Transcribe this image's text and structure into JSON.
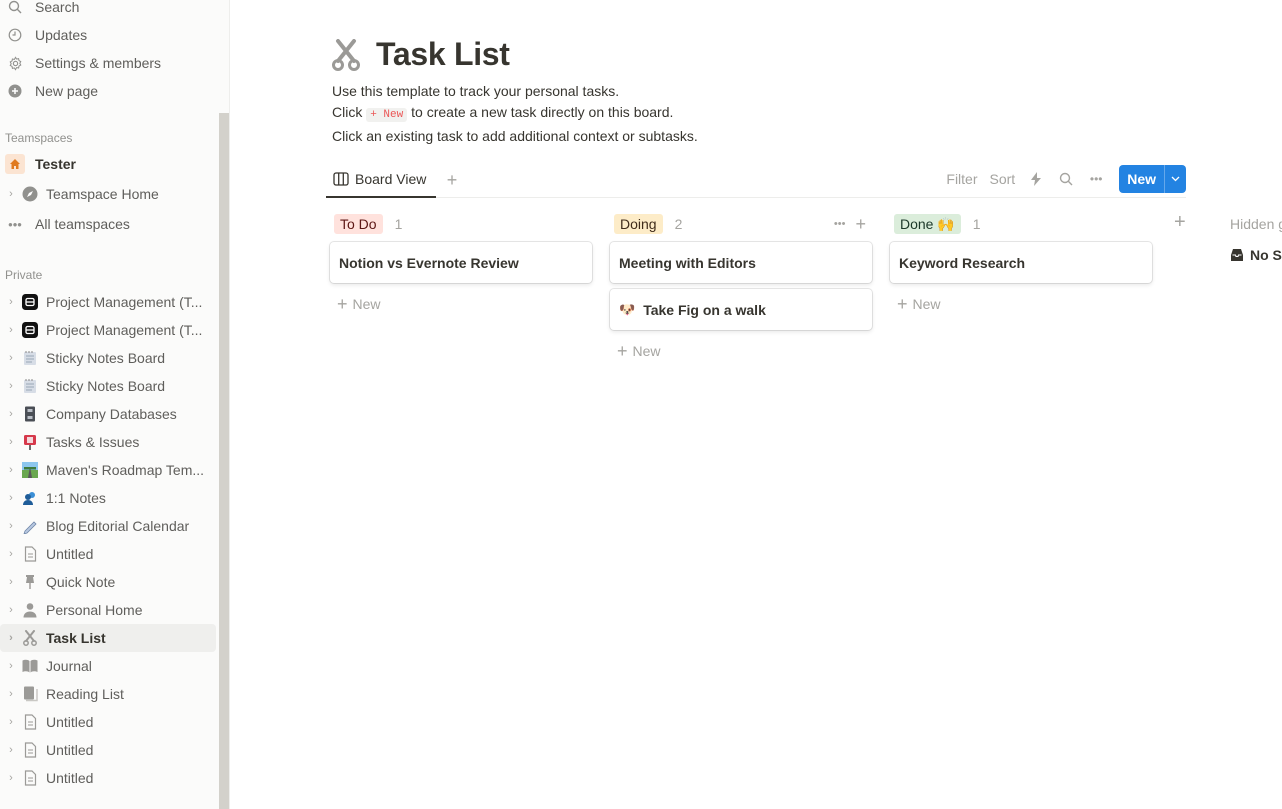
{
  "sidebar": {
    "top_items": [
      {
        "label": "Search",
        "icon": "search-icon"
      },
      {
        "label": "Updates",
        "icon": "clock-icon"
      },
      {
        "label": "Settings & members",
        "icon": "gear-icon"
      },
      {
        "label": "New page",
        "icon": "plus-circle-icon"
      }
    ],
    "teamspaces_header": "Teamspaces",
    "teamspaces": [
      {
        "label": "Tester",
        "icon": "home-icon"
      },
      {
        "label": "Teamspace Home",
        "icon": "compass-icon"
      },
      {
        "label": "All teamspaces",
        "icon": "more-icon"
      }
    ],
    "private_header": "Private",
    "private": [
      {
        "label": "Project Management (T...",
        "icon": "notion-app-icon"
      },
      {
        "label": "Project Management (T...",
        "icon": "notion-app-icon"
      },
      {
        "label": "Sticky Notes Board",
        "icon": "notepad-icon"
      },
      {
        "label": "Sticky Notes Board",
        "icon": "notepad-icon"
      },
      {
        "label": "Company Databases",
        "icon": "file-cabinet-icon"
      },
      {
        "label": "Tasks & Issues",
        "icon": "mailbox-icon"
      },
      {
        "label": "Maven's Roadmap Tem...",
        "icon": "road-icon"
      },
      {
        "label": "1:1 Notes",
        "icon": "people-icon"
      },
      {
        "label": "Blog Editorial Calendar",
        "icon": "pen-icon"
      },
      {
        "label": "Untitled",
        "icon": "document-icon"
      },
      {
        "label": "Quick Note",
        "icon": "pin-icon"
      },
      {
        "label": "Personal Home",
        "icon": "person-icon"
      },
      {
        "label": "Task List",
        "icon": "scissors-icon",
        "active": true
      },
      {
        "label": "Journal",
        "icon": "book-open-icon"
      },
      {
        "label": "Reading List",
        "icon": "book-icon"
      },
      {
        "label": "Untitled",
        "icon": "document-icon"
      },
      {
        "label": "Untitled",
        "icon": "document-icon"
      },
      {
        "label": "Untitled",
        "icon": "document-icon"
      }
    ]
  },
  "page": {
    "title": "Task List",
    "desc_line1": "Use this template to track your personal tasks.",
    "desc_line2_pre": "Click",
    "desc_line2_chip": "+ New",
    "desc_line2_post": "to create a new task directly on this board.",
    "desc_line3": "Click an existing task to add additional context or subtasks."
  },
  "view": {
    "tab_label": "Board View",
    "toolbar": {
      "filter": "Filter",
      "sort": "Sort",
      "new": "New"
    }
  },
  "board": {
    "columns": [
      {
        "name": "To Do",
        "count": "1",
        "bg": "#ffe2dd",
        "fg": "#5d1715",
        "cards": [
          {
            "title": "Notion vs Evernote Review",
            "emoji": ""
          }
        ]
      },
      {
        "name": "Doing",
        "count": "2",
        "bg": "#fdecc8",
        "fg": "#402c1b",
        "cards": [
          {
            "title": "Meeting with Editors",
            "emoji": ""
          },
          {
            "title": "Take Fig on a walk",
            "emoji": "🐶"
          }
        ]
      },
      {
        "name": "Done 🙌",
        "count": "1",
        "bg": "#dbeddb",
        "fg": "#1c3829",
        "cards": [
          {
            "title": "Keyword Research",
            "emoji": ""
          }
        ]
      }
    ],
    "add_new_label": "New",
    "hidden_groups_label": "Hidden groups",
    "no_status_label": "No Status"
  },
  "colors": {
    "accent": "#2383e2"
  }
}
